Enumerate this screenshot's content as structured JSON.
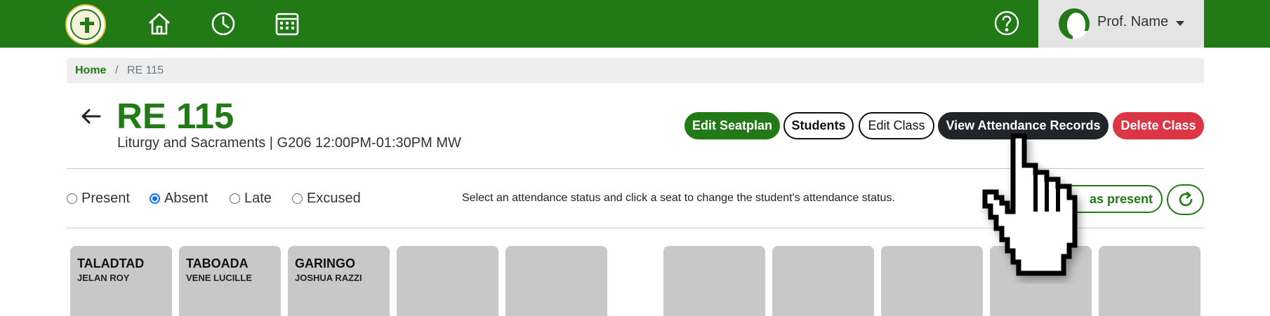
{
  "navbar": {
    "logo_icon": "university-seal-logo",
    "icons": [
      "home-icon",
      "clock-icon",
      "calendar-icon",
      "help-icon"
    ],
    "profile_name": "Prof. Name",
    "color": "#217a16"
  },
  "breadcrumb": {
    "home": "Home",
    "separator": "/",
    "current": "RE 115"
  },
  "course": {
    "code": "RE 115",
    "description": "Liturgy and Sacraments | G206 12:00PM-01:30PM MW"
  },
  "actions": {
    "edit_seatplan": "Edit Seatplan",
    "students": "Students",
    "edit_class": "Edit Class",
    "view_attendance": "View Attendance Records",
    "delete_class": "Delete Class"
  },
  "attendance": {
    "options": [
      "Present",
      "Absent",
      "Late",
      "Excused"
    ],
    "selected": "Absent",
    "instruction": "Select an attendance status and click a seat to change the student's attendance status.",
    "mark_visible_text": "as present",
    "refresh_icon": "refresh-icon"
  },
  "seats": [
    {
      "last": "TALADTAD",
      "first": "JELAN ROY"
    },
    {
      "last": "TABOADA",
      "first": "VENE LUCILLE"
    },
    {
      "last": "GARINGO",
      "first": "JOSHUA RAZZI"
    },
    {
      "last": "",
      "first": ""
    },
    {
      "last": "",
      "first": ""
    },
    {
      "last": "",
      "first": ""
    },
    {
      "last": "",
      "first": ""
    },
    {
      "last": "",
      "first": ""
    },
    {
      "last": "",
      "first": ""
    },
    {
      "last": "",
      "first": ""
    }
  ],
  "colors": {
    "brand_green": "#217a16",
    "dark": "#212529",
    "danger": "#dc3545",
    "seat_gray": "#c8c8c8"
  }
}
